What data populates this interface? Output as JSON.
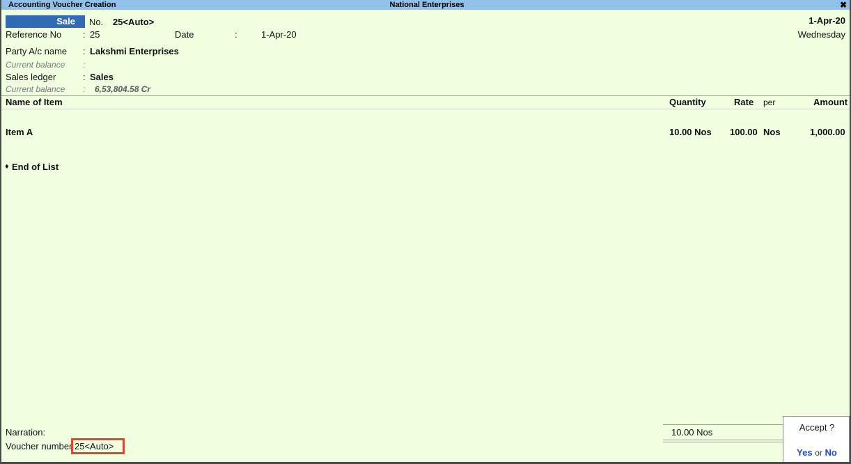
{
  "titlebar": {
    "screen_title": "Accounting Voucher Creation",
    "company_name": "National Enterprises",
    "close_icon": "✖"
  },
  "voucher": {
    "type_label": "Sale",
    "no_label": "No.",
    "no_value": "25<Auto>",
    "reference_label": "Reference No",
    "reference_colon": ":",
    "reference_value": "25",
    "date_label": "Date",
    "date_colon": ":",
    "date_value": "1-Apr-20",
    "header_date": "1-Apr-20",
    "header_day": "Wednesday",
    "party_label": "Party A/c name",
    "party_colon": ":",
    "party_value": "Lakshmi Enterprises",
    "party_balance_label": "Current balance",
    "party_balance_colon": ":",
    "party_balance_value": "",
    "ledger_label": "Sales ledger",
    "ledger_colon": ":",
    "ledger_value": "Sales",
    "ledger_balance_label": "Current balance",
    "ledger_balance_colon": ":",
    "ledger_balance_value": "6,53,804.58 Cr"
  },
  "table": {
    "columns": {
      "name": "Name of Item",
      "quantity": "Quantity",
      "rate": "Rate",
      "per": "per",
      "amount": "Amount"
    },
    "rows": [
      {
        "name": "Item A",
        "quantity": "10.00 Nos",
        "rate": "100.00",
        "per": "Nos",
        "amount": "1,000.00"
      }
    ],
    "end_of_list_bullet": "♦",
    "end_of_list": "End of List"
  },
  "totals": {
    "quantity": "10.00 Nos"
  },
  "footer": {
    "narration_label": "Narration:",
    "narration_value": "",
    "voucher_number_label": "Voucher number",
    "voucher_number_value": "25<Auto>"
  },
  "accept": {
    "title": "Accept ?",
    "yes": "Yes",
    "or": "or",
    "no": "No"
  },
  "colors": {
    "titlebar": "#8fc1ea",
    "background": "#f1ffe1",
    "voucher_chip": "#2f6cb5",
    "highlight": "#e8432a",
    "link": "#1a4fd0"
  }
}
